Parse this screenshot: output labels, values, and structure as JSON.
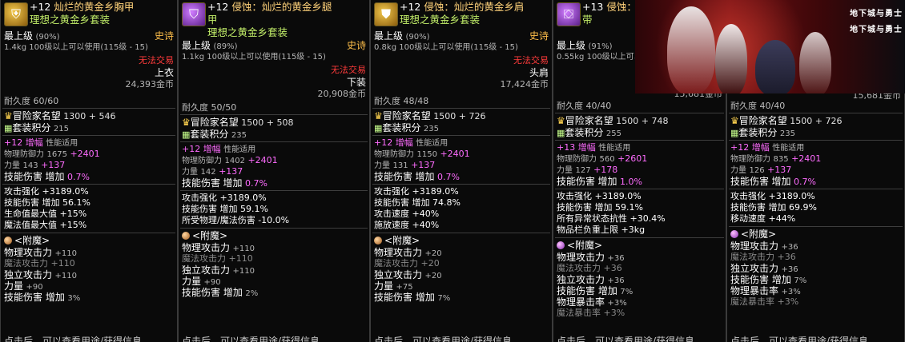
{
  "labels": {
    "max_level": "最上级",
    "epic": "史诗",
    "no_trade": "无法交易",
    "durability_prefix": "耐久度",
    "fame": "冒险家名望",
    "set_points": "套装积分",
    "amplify": "增幅",
    "perf": "性能适用",
    "phys_def": "物理防御力",
    "strength": "力量",
    "skill_dmg": "技能伤害",
    "increase": "增加",
    "enchant": "<附魔>",
    "footer": "点击后，可以查看用途/获得信息"
  },
  "cards": [
    {
      "icon": "armor-chest-icon",
      "title_plus": "+12",
      "title": "灿烂的黄金乡胸甲",
      "subtitle": "理想之黄金乡套装",
      "grade": "(90%)",
      "weight": "1.4kg",
      "usable": "100级以上可以使用(115级 - 15)",
      "slot": "上衣",
      "price": "24,393金币",
      "durability": "60/60",
      "fame": "1300 + 546",
      "set_points": "215",
      "amp_level": "+12",
      "phys_def": "1675",
      "phys_def_bonus": "+2401",
      "strength": "143",
      "strength_bonus": "+137",
      "skill_dmg": "0.7%",
      "stats": [
        "攻击强化 +3189.0%",
        "技能伤害 增加 56.1%",
        "生命值最大值 +15%",
        "魔法值最大值 +15%"
      ],
      "enchant": [
        {
          "label": "物理攻击力",
          "value": "+110",
          "dim": false
        },
        {
          "label": "魔法攻击力",
          "value": "+110",
          "dim": true
        },
        {
          "label": "独立攻击力",
          "value": "+110",
          "dim": false
        },
        {
          "label": "力量",
          "value": "+90",
          "dim": false
        },
        {
          "label": "技能伤害 增加",
          "value": "3%",
          "dim": false
        }
      ],
      "orb": "bronze"
    },
    {
      "icon": "armor-legs-icon",
      "title_plus": "+12",
      "title": "侵蚀：灿烂的黄金乡腿",
      "title2": "甲",
      "subtitle": "理想之黄金乡套装",
      "grade": "(89%)",
      "weight": "1.1kg",
      "usable": "100级以上可以使用(115级 - 15)",
      "slot": "下装",
      "price": "20,908金币",
      "durability": "50/50",
      "fame": "1500 + 508",
      "set_points": "235",
      "amp_level": "+12",
      "phys_def": "1402",
      "phys_def_bonus": "+2401",
      "strength": "142",
      "strength_bonus": "+137",
      "skill_dmg": "0.7%",
      "stats": [
        "攻击强化 +3189.0%",
        "技能伤害 增加 59.1%",
        "所受物理/魔法伤害 -10.0%"
      ],
      "enchant": [
        {
          "label": "物理攻击力",
          "value": "+110",
          "dim": false
        },
        {
          "label": "魔法攻击力",
          "value": "+110",
          "dim": true
        },
        {
          "label": "独立攻击力",
          "value": "+110",
          "dim": false
        },
        {
          "label": "力量",
          "value": "+90",
          "dim": false
        },
        {
          "label": "技能伤害 增加",
          "value": "2%",
          "dim": false
        }
      ],
      "orb": "bronze"
    },
    {
      "icon": "armor-shoulder-icon",
      "title_plus": "+12",
      "title": "侵蚀：灿烂的黄金乡肩",
      "subtitle": "理想之黄金乡套装",
      "grade": "(90%)",
      "weight": "0.8kg",
      "usable": "100级以上可以使用(115级 - 15)",
      "slot": "头肩",
      "price": "17,424金币",
      "durability": "48/48",
      "fame": "1500 + 726",
      "set_points": "235",
      "amp_level": "+12",
      "phys_def": "1150",
      "phys_def_bonus": "+2401",
      "strength": "131",
      "strength_bonus": "+137",
      "skill_dmg": "0.7%",
      "stats": [
        "攻击强化 +3189.0%",
        "技能伤害 增加 74.8%",
        "攻击速度 +40%",
        "施放速度 +40%"
      ],
      "enchant": [
        {
          "label": "物理攻击力",
          "value": "+20",
          "dim": false
        },
        {
          "label": "魔法攻击力",
          "value": "+20",
          "dim": true
        },
        {
          "label": "独立攻击力",
          "value": "+20",
          "dim": false
        },
        {
          "label": "力量",
          "value": "+75",
          "dim": false
        },
        {
          "label": "技能伤害 增加",
          "value": "7%",
          "dim": false
        }
      ],
      "orb": "bronze"
    },
    {
      "icon": "armor-belt-icon",
      "title_plus": "+13",
      "title": "侵蚀：灿烂的黄金乡腰",
      "title2": "带",
      "subtitle": "",
      "grade": "(91%)",
      "weight": "0.55kg",
      "usable": "100级以上可以使用",
      "slot": "",
      "price": "15,681金币",
      "durability": "40/40",
      "fame": "1500 + 748",
      "set_points": "255",
      "amp_level": "+13",
      "phys_def": "560",
      "phys_def_bonus": "+2601",
      "strength": "127",
      "strength_bonus": "+178",
      "skill_dmg": "1.0%",
      "stats": [
        "攻击强化 +3189.0%",
        "技能伤害 增加 59.1%",
        "所有异常状态抗性 +30.4%",
        "物品栏负重上限 +3kg"
      ],
      "enchant": [
        {
          "label": "物理攻击力",
          "value": "+36",
          "dim": false
        },
        {
          "label": "魔法攻击力",
          "value": "+36",
          "dim": true
        },
        {
          "label": "独立攻击力",
          "value": "+36",
          "dim": false
        },
        {
          "label": "技能伤害 增加",
          "value": "7%",
          "dim": false
        },
        {
          "label": "物理暴击率",
          "value": "+3%",
          "dim": false
        },
        {
          "label": "魔法暴击率",
          "value": "+3%",
          "dim": true
        }
      ],
      "orb": "violet"
    },
    {
      "icon": "armor-shoes-icon",
      "title_plus": "",
      "title": "",
      "subtitle": "",
      "grade": "",
      "weight": "",
      "usable": "",
      "slot": "",
      "price": "15,681金币",
      "durability": "40/40",
      "fame": "1500 + 726",
      "set_points": "235",
      "amp_level": "+12",
      "phys_def": "835",
      "phys_def_bonus": "+2401",
      "strength": "126",
      "strength_bonus": "+137",
      "skill_dmg": "0.7%",
      "stats": [
        "攻击强化 +3189.0%",
        "技能伤害 增加 69.9%",
        "移动速度 +44%"
      ],
      "enchant": [
        {
          "label": "物理攻击力",
          "value": "+36",
          "dim": false
        },
        {
          "label": "魔法攻击力",
          "value": "+36",
          "dim": true
        },
        {
          "label": "独立攻击力",
          "value": "+36",
          "dim": false
        },
        {
          "label": "技能伤害 增加",
          "value": "7%",
          "dim": false
        },
        {
          "label": "物理暴击率",
          "value": "+3%",
          "dim": false
        },
        {
          "label": "魔法暴击率",
          "value": "+3%",
          "dim": true
        }
      ],
      "orb": "violet"
    }
  ],
  "banner": {
    "logo_line1": "地下城与勇士",
    "logo_line2": "地下城与勇士"
  }
}
